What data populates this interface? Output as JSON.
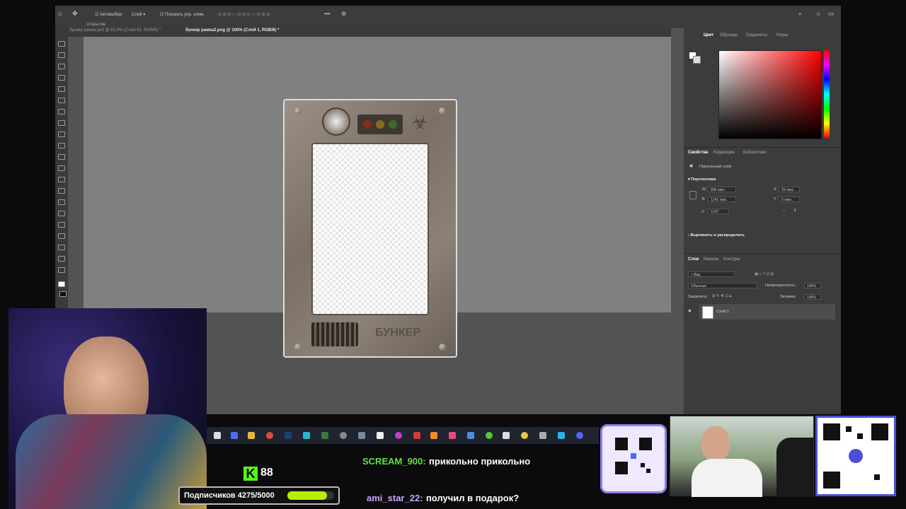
{
  "optionsbar": {
    "autoselect": "Автовыбор:",
    "layer_select": "Слой",
    "show_transform": "Показать упр. элем."
  },
  "tabs": [
    {
      "label": "Открытие"
    },
    {
      "label": "бункер рамка.psd @ 82,6% (Слой 82, RGB/8) *"
    },
    {
      "label": "бункер рамка2.png @ 100% (Слой 1, RGB/8) *"
    }
  ],
  "frame_text": "БУНКЕР",
  "right_panel": {
    "color_tabs": [
      "Цвет",
      "Образцы",
      "Градиенты",
      "Узоры"
    ],
    "props_tabs": [
      "Свойства",
      "Коррекция",
      "Библиотеки"
    ],
    "pixel_layer": "Пиксельный слой",
    "perspective": "Перспектива",
    "w_label": "Ш",
    "w_value": "808 пикс.",
    "h_label": "В",
    "h_value": "1241 пикс.",
    "x_label": "X",
    "x_value": "20 пикс.",
    "y_label": "Y",
    "y_value": "0 пикс.",
    "angle": "0,00°",
    "align": "Выровнять и распределить",
    "layers_tabs": [
      "Слои",
      "Каналы",
      "Контуры"
    ],
    "filter": "Вид",
    "blend": "Обычные",
    "opacity_label": "Непрозрачность:",
    "opacity_value": "100%",
    "lock_label": "Закрепить:",
    "fill_label": "Заливка:",
    "fill_value": "100%",
    "layer_name": "Слой 1"
  },
  "overlay": {
    "kick_count": "88",
    "subs": "Подписчиков 4275/5000",
    "subs_progress": 0.855,
    "chat": [
      {
        "user": "SCREAM_900:",
        "text": "прикольно прикольно",
        "user_color": "#5fe040"
      },
      {
        "user": "ami_star_22:",
        "text": "получил в подарок?",
        "user_color": "#c6a6ff"
      }
    ]
  },
  "colors": {
    "accent": "#b5f000",
    "ps_bg": "#535353",
    "panel": "#3c3c3c",
    "picker_red": "#ff0000"
  }
}
